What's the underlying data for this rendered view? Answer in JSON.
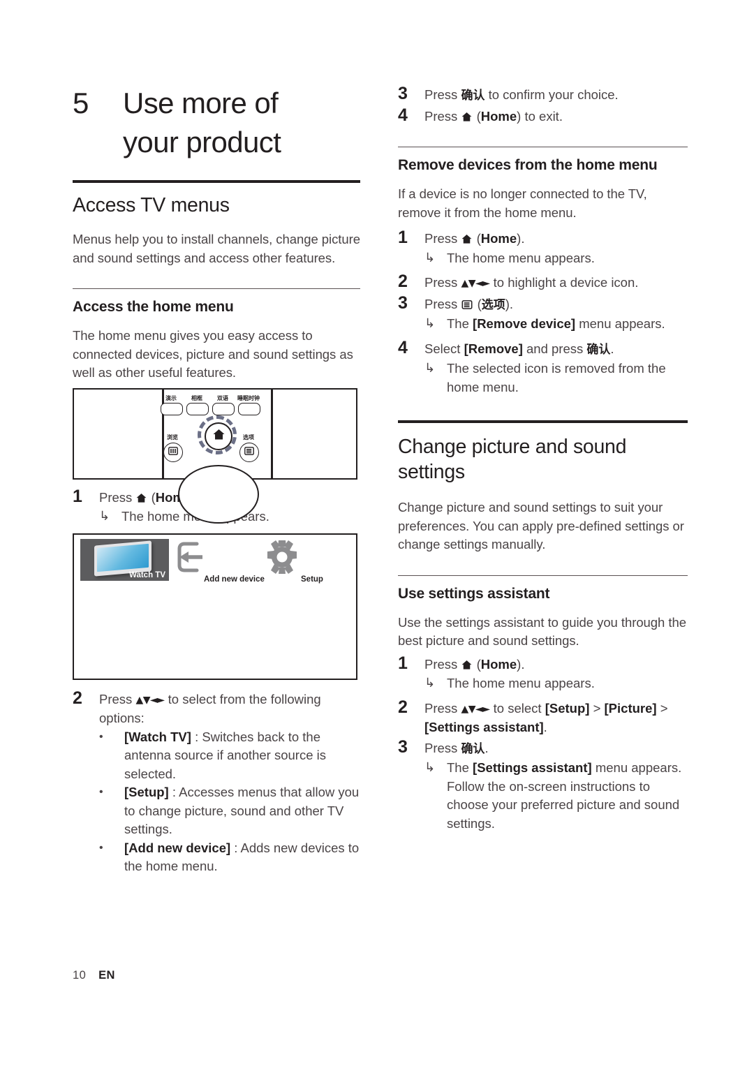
{
  "document": {
    "footer": {
      "page_number": "10",
      "language": "EN"
    }
  },
  "left_column": {
    "chapter": {
      "number": "5",
      "title_line1": "Use more of",
      "title_line2": "your product"
    },
    "section_title": "Access TV menus",
    "section_intro": "Menus help you to install channels, change picture and sound settings and access other features.",
    "subsection_title": "Access the home menu",
    "subsection_intro": "The home menu gives you easy access to connected devices, picture and sound settings as well as other useful features.",
    "remote_figure": {
      "name": "remote-control-illustration",
      "top_buttons": [
        {
          "label": "演示",
          "meaning": "demo"
        },
        {
          "label": "相框",
          "meaning": "photo-frame"
        },
        {
          "label": "双语",
          "meaning": "bilingual"
        },
        {
          "label": "睡眠时钟",
          "meaning": "sleep-timer"
        }
      ],
      "browse_label": "浏览",
      "options_label": "选项",
      "center_button": "home-icon"
    },
    "step1": {
      "number": "1",
      "text_before": "Press",
      "icon": "home-icon",
      "text_after": "(Home).",
      "home_bold": "Home",
      "result": "The home menu appears."
    },
    "home_menu_figure": {
      "name": "home-menu-screen",
      "items": [
        {
          "label": "Watch TV",
          "icon": "tv-icon",
          "selected": true
        },
        {
          "label": "Add new device",
          "icon": "add-device-icon",
          "selected": false
        },
        {
          "label": "Setup",
          "icon": "gear-icon",
          "selected": false
        }
      ]
    },
    "step2": {
      "number": "2",
      "text_before": "Press",
      "navpad": "▲▼◄►",
      "text_after": "to select from the following options:",
      "bullets": [
        {
          "term": "[Watch TV]",
          "desc": ": Switches back to the antenna source if another source is selected."
        },
        {
          "term": "[Setup]",
          "desc": ": Accesses menus that allow you to change picture, sound and other TV settings."
        },
        {
          "term": "[Add new device]",
          "desc": ": Adds new devices to the home menu."
        }
      ]
    }
  },
  "right_column": {
    "step3": {
      "number": "3",
      "text_before": "Press",
      "cn": "确认",
      "text_after": "to confirm your choice."
    },
    "step4": {
      "number": "4",
      "text_before": "Press",
      "icon": "home-icon",
      "home_bold": "Home",
      "text_after": "to exit."
    },
    "section_remove": {
      "title": "Remove devices from the home menu",
      "intro": "If a device is no longer connected to the TV, remove it from the home menu.",
      "steps": [
        {
          "number": "1",
          "text_before": "Press",
          "icon": "home-icon",
          "home_bold": "Home",
          "text_after": ").",
          "result": "The home menu appears."
        },
        {
          "number": "2",
          "text_before": "Press",
          "navpad": "▲▼◄►",
          "text_after": "to highlight a device icon."
        },
        {
          "number": "3",
          "text_before": "Press",
          "icon": "options-icon",
          "cn": "选项",
          "text_after": ").",
          "result_before": "The",
          "result_bold": "[Remove device]",
          "result_after": "menu appears."
        },
        {
          "number": "4",
          "text_before": "Select",
          "bold": "[Remove]",
          "text_mid": "and press",
          "cn": "确认",
          "text_after": ".",
          "result": "The selected icon is removed from the home menu."
        }
      ]
    },
    "section_change": {
      "title_line1": "Change picture and sound",
      "title_line2": "settings",
      "intro": "Change picture and sound settings to suit your preferences. You can apply pre-defined settings or change settings manually.",
      "subsection_title": "Use settings assistant",
      "subsection_intro": "Use the settings assistant to guide you through the best picture and sound settings.",
      "steps": [
        {
          "number": "1",
          "text_before": "Press",
          "icon": "home-icon",
          "home_bold": "Home",
          "text_after": ").",
          "result": "The home menu appears."
        },
        {
          "number": "2",
          "text_before": "Press",
          "navpad": "▲▼◄►",
          "text_mid": "to select",
          "bold1": "[Setup]",
          "gt1": ">",
          "bold2": "[Picture]",
          "gt2": ">",
          "bold3": "[Settings assistant]",
          "text_after": "."
        },
        {
          "number": "3",
          "text_before": "Press",
          "cn": "确认",
          "text_after": ".",
          "result_before": "The",
          "result_bold": "[Settings assistant]",
          "result_after": "menu appears. Follow the on-screen instructions to choose your preferred picture and sound settings."
        }
      ]
    }
  },
  "colors": {
    "text": "#4a4446",
    "heading": "#231f20",
    "rule": "#231f20",
    "tile_selected_bg": "#5c5c5e",
    "icon_gray": "#8a8a8c",
    "tv_screen_blue": "#2e9ad0"
  }
}
